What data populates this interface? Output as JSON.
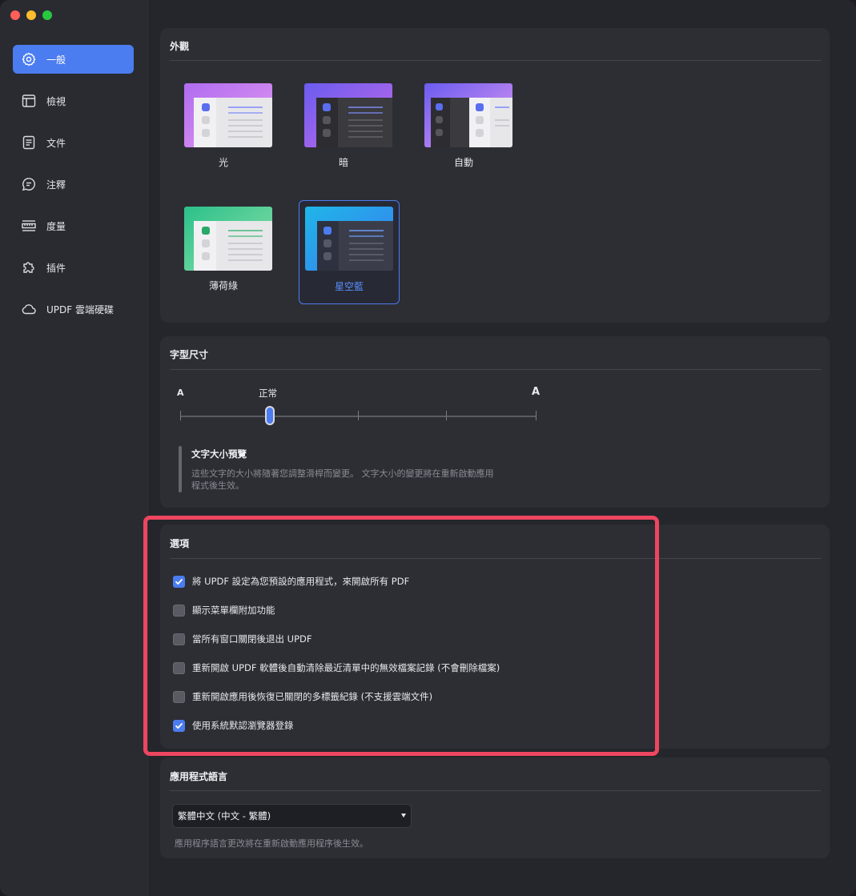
{
  "window": {
    "controls": {
      "close_color": "#ff5f57",
      "minimize_color": "#febc2e",
      "zoom_color": "#28c840"
    }
  },
  "sidebar": {
    "items": [
      {
        "label": "一般",
        "icon": "gear-icon",
        "active": true
      },
      {
        "label": "檢視",
        "icon": "layout-icon",
        "active": false
      },
      {
        "label": "文件",
        "icon": "document-icon",
        "active": false
      },
      {
        "label": "注釋",
        "icon": "comment-icon",
        "active": false
      },
      {
        "label": "度量",
        "icon": "ruler-icon",
        "active": false
      },
      {
        "label": "插件",
        "icon": "puzzle-icon",
        "active": false
      },
      {
        "label": "UPDF 雲端硬碟",
        "icon": "cloud-icon",
        "active": false
      }
    ]
  },
  "appearance": {
    "title": "外觀",
    "themes": [
      {
        "label": "光",
        "selected": false
      },
      {
        "label": "暗",
        "selected": false
      },
      {
        "label": "自動",
        "selected": false
      },
      {
        "label": "薄荷綠",
        "selected": false
      },
      {
        "label": "星空藍",
        "selected": true
      }
    ]
  },
  "font_size": {
    "title": "字型尺寸",
    "min_label": "A",
    "max_label": "A",
    "current_label": "正常",
    "steps": 5,
    "current_step": 2,
    "preview_title": "文字大小預覽",
    "preview_text_line1": "這些文字的大小將隨著您調整滑桿而變更。 文字大小的變更將在重新啟動應用",
    "preview_text_line2": "程式後生效。"
  },
  "options": {
    "title": "選項",
    "items": [
      {
        "label": "將 UPDF 設定為您預設的應用程式，來開啟所有 PDF",
        "checked": true
      },
      {
        "label": "顯示菜單欄附加功能",
        "checked": false
      },
      {
        "label": "當所有窗口關閉後退出 UPDF",
        "checked": false
      },
      {
        "label": "重新開啟 UPDF 軟體後自動清除最近清單中的無效檔案記錄 (不會刪除檔案)",
        "checked": false
      },
      {
        "label": "重新開啟應用後恢復已關閉的多標籤紀錄 (不支援雲端文件)",
        "checked": false
      },
      {
        "label": "使用系統默認瀏覽器登錄",
        "checked": true
      }
    ]
  },
  "language": {
    "title": "應用程式語言",
    "selected": "繁體中文 (中文 - 繁體)",
    "note": "應用程序語言更改將在重新啟動應用程序後生效。"
  },
  "colors": {
    "accent": "#4b7cf0",
    "highlight_border": "#ee4660"
  }
}
